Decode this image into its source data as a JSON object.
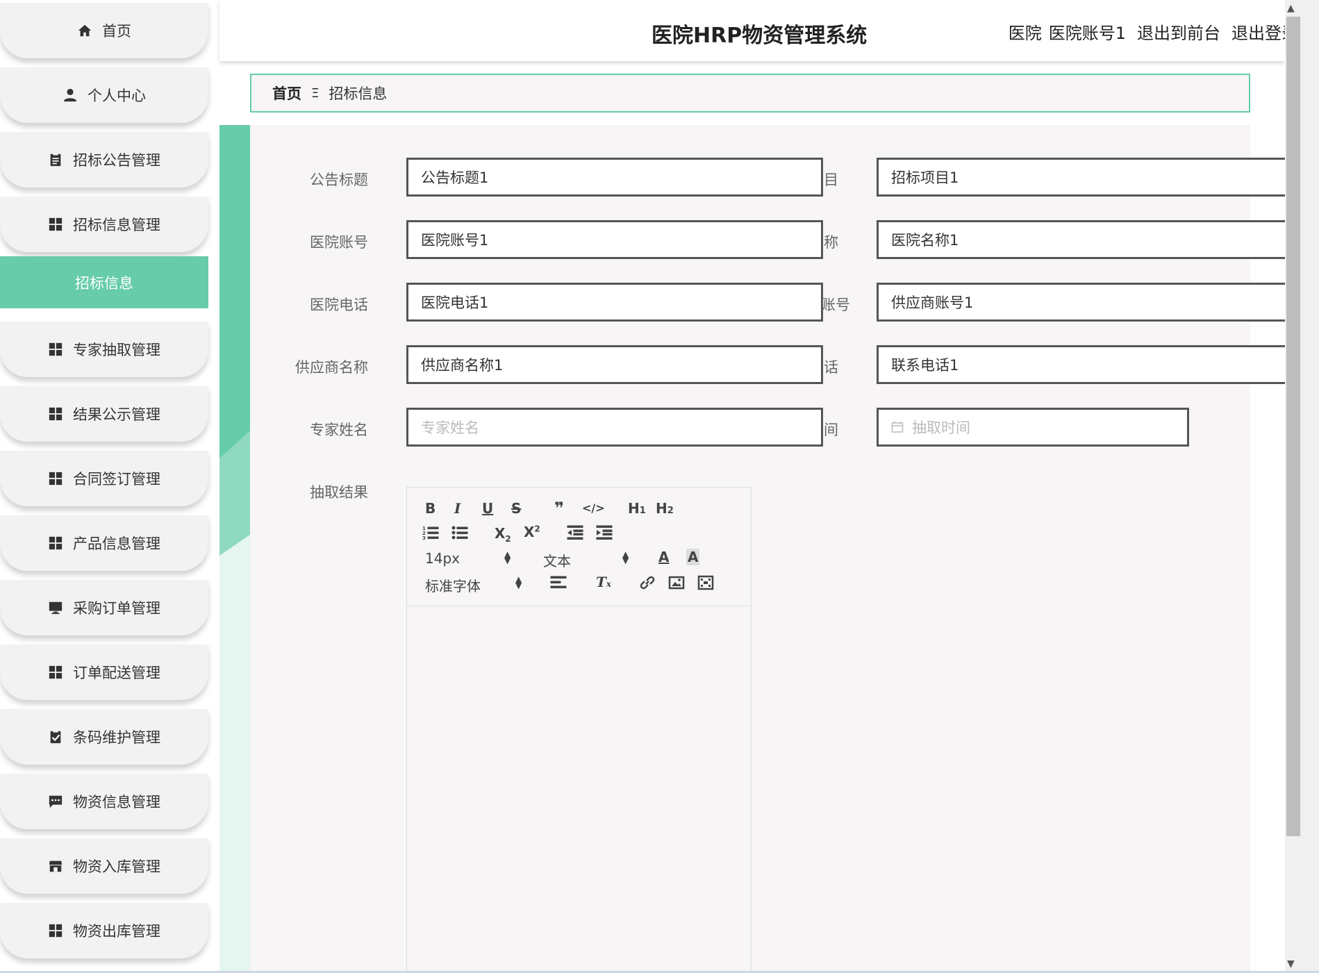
{
  "header": {
    "title": "医院HRP物资管理系统",
    "user_role": "医院",
    "user_account": "医院账号1",
    "back_to_front": "退出到前台",
    "logout": "退出登录"
  },
  "sidebar": {
    "items": [
      {
        "label": "首页",
        "icon": "home-icon"
      },
      {
        "label": "个人中心",
        "icon": "user-icon"
      },
      {
        "label": "招标公告管理",
        "icon": "clipboard-icon"
      },
      {
        "label": "招标信息管理",
        "icon": "grid-icon"
      },
      {
        "label": "专家抽取管理",
        "icon": "grid-icon"
      },
      {
        "label": "结果公示管理",
        "icon": "grid-icon"
      },
      {
        "label": "合同签订管理",
        "icon": "grid-icon"
      },
      {
        "label": "产品信息管理",
        "icon": "grid-icon"
      },
      {
        "label": "采购订单管理",
        "icon": "monitor-icon"
      },
      {
        "label": "订单配送管理",
        "icon": "grid-icon"
      },
      {
        "label": "条码维护管理",
        "icon": "clipboard-check-icon"
      },
      {
        "label": "物资信息管理",
        "icon": "chat-icon"
      },
      {
        "label": "物资入库管理",
        "icon": "store-icon"
      },
      {
        "label": "物资出库管理",
        "icon": "grid-icon"
      }
    ],
    "active_sub_item": "招标信息",
    "accent_color": "#66ccaa"
  },
  "breadcrumb": {
    "home": "首页",
    "separator": "Ξ",
    "current": "招标信息"
  },
  "form": {
    "left": [
      {
        "label": "公告标题",
        "value": "公告标题1",
        "placeholder": ""
      },
      {
        "label": "医院账号",
        "value": "医院账号1",
        "placeholder": ""
      },
      {
        "label": "医院电话",
        "value": "医院电话1",
        "placeholder": ""
      },
      {
        "label": "供应商名称",
        "value": "供应商名称1",
        "placeholder": ""
      },
      {
        "label": "专家姓名",
        "value": "",
        "placeholder": "专家姓名"
      }
    ],
    "right": [
      {
        "label_fragment": "目",
        "value": "招标项目1",
        "placeholder": ""
      },
      {
        "label_fragment": "称",
        "value": "医院名称1",
        "placeholder": ""
      },
      {
        "label_fragment": "账号",
        "value": "供应商账号1",
        "placeholder": ""
      },
      {
        "label_fragment": "话",
        "value": "联系电话1",
        "placeholder": ""
      },
      {
        "label_fragment": "间",
        "value": "",
        "placeholder": "抽取时间",
        "icon": "calendar-icon"
      }
    ],
    "result_label": "抽取结果"
  },
  "editor": {
    "font_size": "14px",
    "text_type": "文本",
    "font_family": "标准字体"
  }
}
